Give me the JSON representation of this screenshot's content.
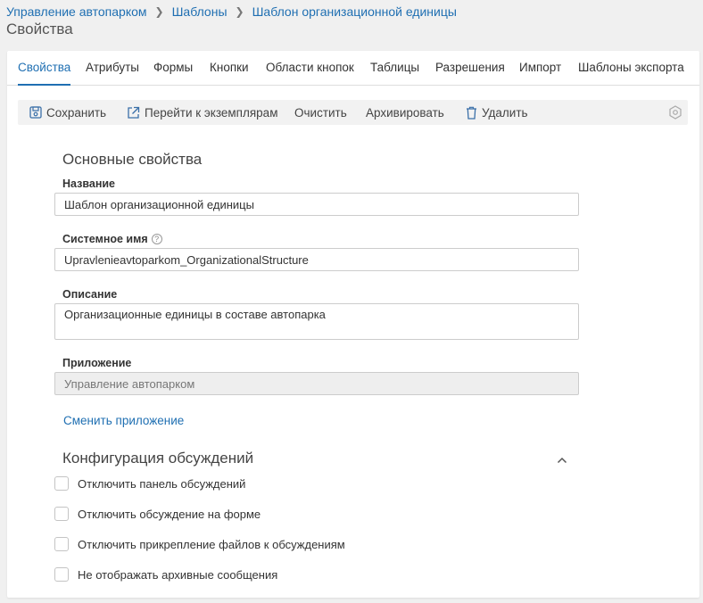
{
  "breadcrumb": {
    "items": [
      "Управление автопарком",
      "Шаблоны",
      "Шаблон организационной единицы"
    ]
  },
  "page": {
    "title": "Свойства"
  },
  "tabs": [
    {
      "label": "Свойства",
      "active": true
    },
    {
      "label": "Атрибуты",
      "active": false
    },
    {
      "label": "Формы",
      "active": false
    },
    {
      "label": "Кнопки",
      "active": false
    },
    {
      "label": "Области кнопок",
      "active": false
    },
    {
      "label": "Таблицы",
      "active": false
    },
    {
      "label": "Разрешения",
      "active": false
    },
    {
      "label": "Импорт",
      "active": false
    },
    {
      "label": "Шаблоны экспорта",
      "active": false
    }
  ],
  "toolbar": {
    "save": "Сохранить",
    "goto_instances": "Перейти к экземплярам",
    "clear": "Очистить",
    "archive": "Архивировать",
    "delete": "Удалить"
  },
  "basic": {
    "title": "Основные свойства",
    "name_label": "Название",
    "name_value": "Шаблон организационной единицы",
    "system_name_label": "Системное имя",
    "system_name_value": "Upravlenieavtoparkom_OrganizationalStructure",
    "description_label": "Описание",
    "description_value": "Организационные единицы в составе автопарка",
    "app_label": "Приложение",
    "app_value": "Управление автопарком",
    "change_app_link": "Сменить приложение"
  },
  "discussions": {
    "title": "Конфигурация обсуждений",
    "options": [
      {
        "label": "Отключить панель обсуждений",
        "checked": false
      },
      {
        "label": "Отключить обсуждение на форме",
        "checked": false
      },
      {
        "label": "Отключить прикрепление файлов к обсуждениям",
        "checked": false
      },
      {
        "label": "Не отображать архивные сообщения",
        "checked": false
      }
    ]
  },
  "colors": {
    "accent": "#1f6fb2",
    "background": "#f0f0f0",
    "toolbar_bg": "#f2f2f2",
    "disabled_input": "#eeeeee"
  }
}
